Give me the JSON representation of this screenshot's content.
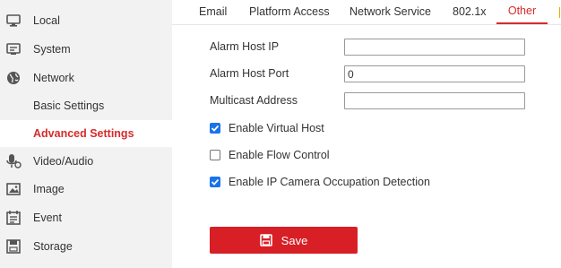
{
  "sidebar": {
    "items": [
      {
        "label": "Local",
        "icon": "monitor-icon"
      },
      {
        "label": "System",
        "icon": "system-icon"
      },
      {
        "label": "Network",
        "icon": "globe-icon"
      },
      {
        "label": "Basic Settings"
      },
      {
        "label": "Advanced Settings"
      },
      {
        "label": "Video/Audio",
        "icon": "video-audio-icon"
      },
      {
        "label": "Image",
        "icon": "image-icon"
      },
      {
        "label": "Event",
        "icon": "event-icon"
      },
      {
        "label": "Storage",
        "icon": "storage-icon"
      }
    ],
    "active_color": "#d62b2b"
  },
  "tabs": [
    "Email",
    "Platform Access",
    "Network Service",
    "802.1x",
    "Other"
  ],
  "active_tab": "Other",
  "form": {
    "alarm_host_ip_label": "Alarm Host IP",
    "alarm_host_ip_value": "",
    "alarm_host_port_label": "Alarm Host Port",
    "alarm_host_port_value": "0",
    "multicast_address_label": "Multicast Address",
    "multicast_address_value": ""
  },
  "options": [
    {
      "label": "Enable Virtual Host",
      "checked": true
    },
    {
      "label": "Enable Flow Control",
      "checked": false
    },
    {
      "label": "Enable IP Camera Occupation Detection",
      "checked": true
    }
  ],
  "save_label": "Save",
  "colors": {
    "accent": "#d81f26",
    "checkbox": "#1a73e8"
  }
}
